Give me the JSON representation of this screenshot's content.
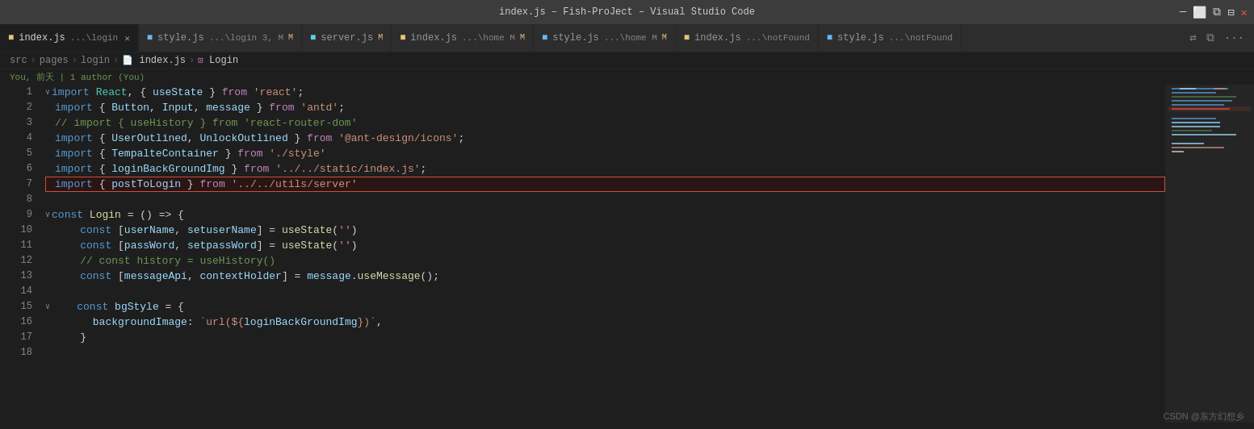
{
  "titleBar": {
    "title": "index.js – Fish-ProJect – Visual Studio Code"
  },
  "tabs": [
    {
      "id": "tab1",
      "icon": "📄",
      "label": "index.js",
      "path": "...\\login",
      "active": true,
      "dirty": false,
      "modified": false,
      "close": true
    },
    {
      "id": "tab2",
      "icon": "📄",
      "label": "style.js",
      "path": "...\\login 3, M",
      "active": false,
      "dirty": false,
      "modified": true,
      "close": false
    },
    {
      "id": "tab3",
      "icon": "📄",
      "label": "server.js",
      "path": "",
      "active": false,
      "dirty": false,
      "modified": true,
      "close": false
    },
    {
      "id": "tab4",
      "icon": "📄",
      "label": "index.js",
      "path": "...\\home M",
      "active": false,
      "dirty": false,
      "modified": true,
      "close": false
    },
    {
      "id": "tab5",
      "icon": "📄",
      "label": "style.js",
      "path": "...\\home M",
      "active": false,
      "dirty": false,
      "modified": true,
      "close": false
    },
    {
      "id": "tab6",
      "icon": "📄",
      "label": "index.js",
      "path": "...\\notFound",
      "active": false,
      "dirty": false,
      "modified": false,
      "close": false
    },
    {
      "id": "tab7",
      "icon": "📄",
      "label": "style.js",
      "path": "...\\notFound",
      "active": false,
      "dirty": false,
      "modified": false,
      "close": false
    }
  ],
  "breadcrumb": {
    "items": [
      "src",
      "pages",
      "login",
      "index.js",
      "Login"
    ]
  },
  "blame": {
    "text": "You, 前天 | 1 author (You)"
  },
  "lines": [
    {
      "num": 1,
      "fold": true,
      "content": "import React, { useState } from 'react';"
    },
    {
      "num": 2,
      "fold": false,
      "content": "import { Button, Input, message } from 'antd';"
    },
    {
      "num": 3,
      "fold": false,
      "content": "// import { useHistory } from 'react-router-dom'"
    },
    {
      "num": 4,
      "fold": false,
      "content": "import { UserOutlined, UnlockOutlined } from '@ant-design/icons';"
    },
    {
      "num": 5,
      "fold": false,
      "content": "import { TempalteContainer } from './style'"
    },
    {
      "num": 6,
      "fold": false,
      "content": "import { loginBackGroundImg } from '../../static/index.js';"
    },
    {
      "num": 7,
      "fold": false,
      "content": "import { postToLogin } from '../../utils/server'"
    },
    {
      "num": 8,
      "fold": false,
      "content": ""
    },
    {
      "num": 9,
      "fold": true,
      "content": "const Login = () => {"
    },
    {
      "num": 10,
      "fold": false,
      "content": "    const [userName, setuserName] = useState('')"
    },
    {
      "num": 11,
      "fold": false,
      "content": "    const [passWord, setpassWord] = useState('')"
    },
    {
      "num": 12,
      "fold": false,
      "content": "    // const history = useHistory()"
    },
    {
      "num": 13,
      "fold": false,
      "content": "    const [messageApi, contextHolder] = message.useMessage();"
    },
    {
      "num": 14,
      "fold": false,
      "content": ""
    },
    {
      "num": 15,
      "fold": true,
      "content": "    const bgStyle = {"
    },
    {
      "num": 16,
      "fold": false,
      "content": "      backgroundImage: `url(${loginBackGroundImg})`,"
    },
    {
      "num": 17,
      "fold": false,
      "content": "    }"
    },
    {
      "num": 18,
      "fold": false,
      "content": ""
    }
  ],
  "watermark": "CSDN @东方幻想乡",
  "colors": {
    "keyword": "#569cd6",
    "string": "#ce9178",
    "comment": "#6a9955",
    "class": "#4ec9b0",
    "variable": "#9cdcfe",
    "function": "#dcdcaa",
    "purple": "#c586c0",
    "active_line_bg": "#264f78",
    "error_line_bg": "#2a1515"
  }
}
